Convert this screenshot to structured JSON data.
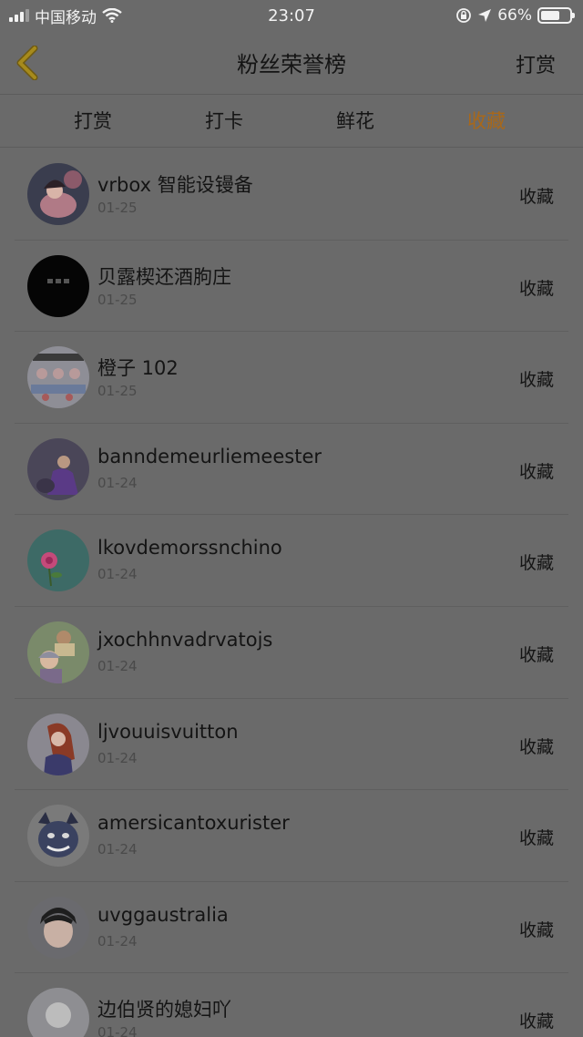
{
  "status_bar": {
    "carrier": "中国移动",
    "time": "23:07",
    "battery_percent": "66%",
    "battery_level": 0.66
  },
  "nav": {
    "title": "粉丝荣誉榜",
    "right_action": "打赏"
  },
  "tabs": [
    {
      "label": "打赏",
      "active": false
    },
    {
      "label": "打卡",
      "active": false
    },
    {
      "label": "鲜花",
      "active": false
    },
    {
      "label": "收藏",
      "active": true
    }
  ],
  "accent_color": "#a8681a",
  "list": [
    {
      "name": "vrbox 智能设镘备",
      "date": "01-25",
      "action": "收藏",
      "avatar_icon": "girl-portrait-avatar"
    },
    {
      "name": "贝露楔还酒朐庄",
      "date": "01-25",
      "action": "收藏",
      "avatar_icon": "black-text-avatar"
    },
    {
      "name": "橙子 102",
      "date": "01-25",
      "action": "收藏",
      "avatar_icon": "group-photo-avatar"
    },
    {
      "name": "banndemeurliemeester",
      "date": "01-24",
      "action": "收藏",
      "avatar_icon": "purple-dress-avatar"
    },
    {
      "name": "lkovdemorssnchino",
      "date": "01-24",
      "action": "收藏",
      "avatar_icon": "pink-flower-avatar"
    },
    {
      "name": "jxochhnvadrvatojs",
      "date": "01-24",
      "action": "收藏",
      "avatar_icon": "kids-photo-avatar"
    },
    {
      "name": "ljvouuisvuitton",
      "date": "01-24",
      "action": "收藏",
      "avatar_icon": "anime-girl-avatar"
    },
    {
      "name": "amersicantoxurister",
      "date": "01-24",
      "action": "收藏",
      "avatar_icon": "cartoon-monster-avatar"
    },
    {
      "name": "uvggaustralia",
      "date": "01-24",
      "action": "收藏",
      "avatar_icon": "boy-portrait-avatar"
    },
    {
      "name": "边伯贤的媳妇吖",
      "date": "01-24",
      "action": "收藏",
      "avatar_icon": "person-portrait-avatar"
    }
  ]
}
